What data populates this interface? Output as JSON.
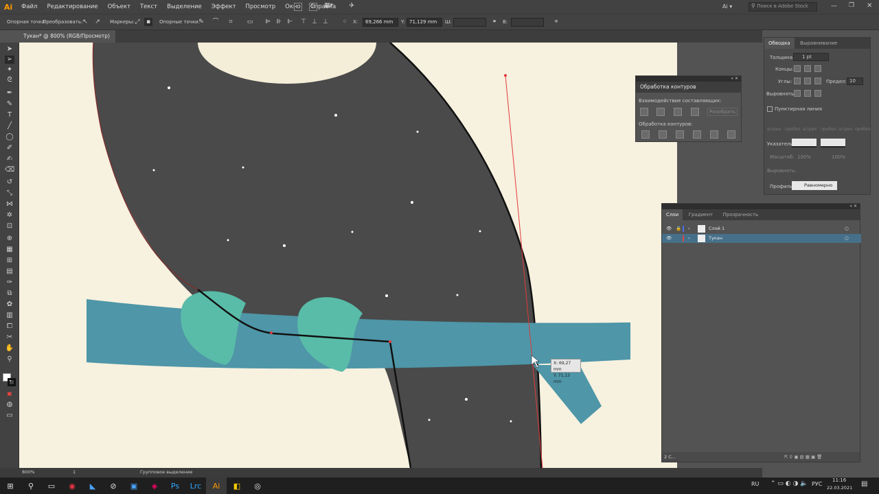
{
  "menubar": {
    "logo": "Ai",
    "items": [
      "Файл",
      "Редактирование",
      "Объект",
      "Текст",
      "Выделение",
      "Эффект",
      "Просмотр",
      "Окно",
      "Справка"
    ],
    "workspace": "Ai",
    "search_placeholder": "Поиск в Adobe Stock"
  },
  "controlbar": {
    "anchor_label": "Опорная точка",
    "convert_label": "Преобразовать:",
    "handles_label": "Маркеры:",
    "anchors_label": "Опорные точки:",
    "x_label": "X:",
    "x_value": "69,266 mm",
    "y_label": "Y:",
    "y_value": "71,129 mm",
    "w_label": "Ш:",
    "h_label": "В:"
  },
  "document": {
    "tab_label": "Тукан* @ 800% (RGB/Просмотр)",
    "close": "×",
    "cursor_x": "X: 69,27 mm",
    "cursor_y": "Y: 71,13 mm"
  },
  "pathfinder": {
    "title": "Обработка контуров",
    "shape_modes_label": "Взаимодействие составляющих:",
    "expand_label": "Разобрать",
    "pathfinders_label": "Обработка контуров:"
  },
  "stroke_panel": {
    "tab_stroke": "Обводка",
    "tab_align": "Выравнивание",
    "weight_label": "Толщина:",
    "weight_value": "1 pt",
    "cap_label": "Концы:",
    "corner_label": "Углы:",
    "limit_label": "Предел:",
    "limit_value": "10",
    "align_label": "Выровнять:",
    "dashed_label": "Пунктирная линия",
    "dash_fields": [
      "штрих",
      "пробел",
      "штрих",
      "пробел",
      "штрих",
      "пробел"
    ],
    "arrowheads_label": "Указатели:",
    "scale_label": "Масштаб:",
    "scale_values": [
      "100%",
      "100%"
    ],
    "align_arrows_label": "Выровнять:",
    "profile_label": "Профиль:",
    "profile_value": "Равномерно"
  },
  "layers_panel": {
    "tab_layers": "Слои",
    "tab_gradient": "Градиент",
    "tab_transparency": "Прозрачность",
    "layers": [
      {
        "name": "Слой 1",
        "color": "#4f6ee8",
        "selected": false
      },
      {
        "name": "Тукан",
        "color": "#e04646",
        "selected": true
      }
    ],
    "footer_count": "2 С..."
  },
  "statusbar": {
    "zoom": "800%",
    "artboard": "1",
    "status": "Групповое выделение"
  },
  "taskbar": {
    "lang": "RU",
    "input": "РУС",
    "time": "11:16",
    "date": "22.03.2021"
  },
  "colors": {
    "artboard_bg": "#f7f1df",
    "body": "#4a4a4a",
    "branch": "#4e96a8",
    "feet": "#59bca8",
    "layer_selected": "#46708a"
  }
}
